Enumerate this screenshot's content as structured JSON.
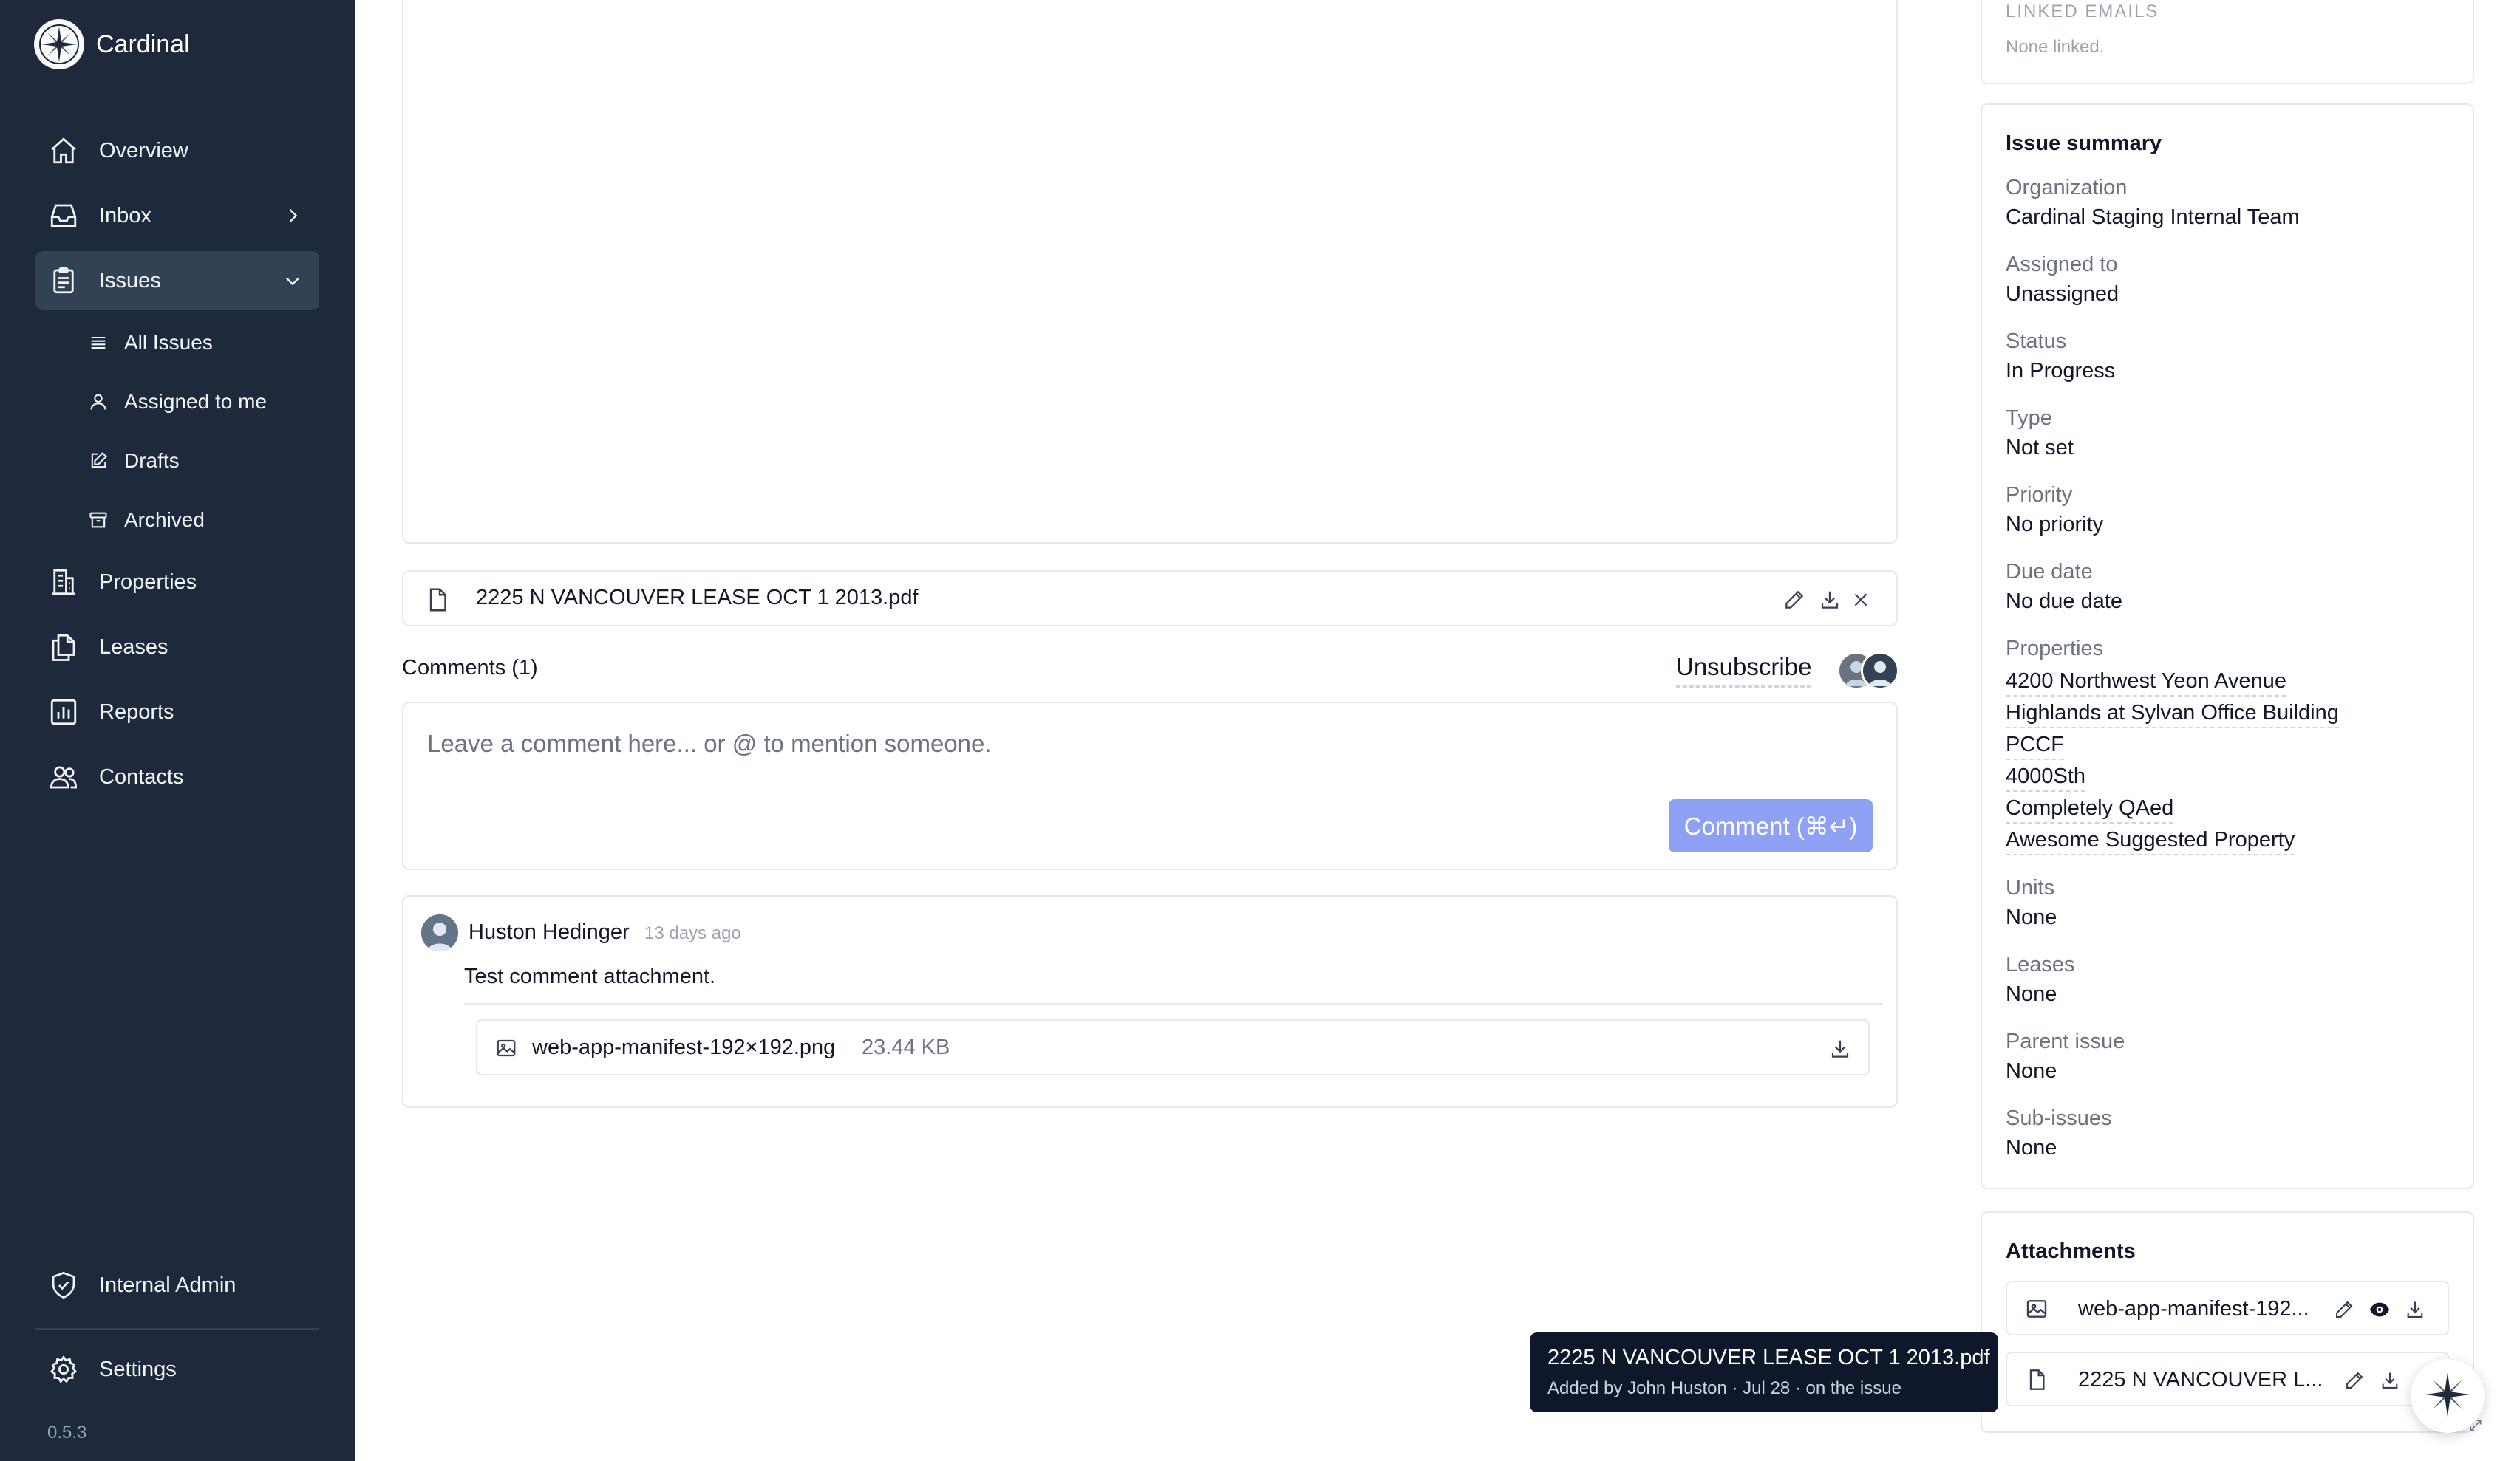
{
  "app": {
    "name": "Cardinal",
    "version": "0.5.3"
  },
  "sidebar": {
    "nav": [
      {
        "label": "Overview",
        "icon": "home-icon"
      },
      {
        "label": "Inbox",
        "icon": "inbox-icon"
      },
      {
        "label": "Issues",
        "icon": "clipboard-icon",
        "active": true
      },
      {
        "label": "Properties",
        "icon": "building-icon"
      },
      {
        "label": "Leases",
        "icon": "documents-icon"
      },
      {
        "label": "Reports",
        "icon": "chart-icon"
      },
      {
        "label": "Contacts",
        "icon": "users-icon"
      }
    ],
    "issues_sub": [
      {
        "label": "All Issues",
        "icon": "list-icon"
      },
      {
        "label": "Assigned to me",
        "icon": "user-icon"
      },
      {
        "label": "Drafts",
        "icon": "pencil-square-icon"
      },
      {
        "label": "Archived",
        "icon": "archive-icon"
      }
    ],
    "internal_admin": "Internal Admin",
    "settings": "Settings"
  },
  "main": {
    "attached_file": "2225 N VANCOUVER LEASE OCT 1 2013.pdf",
    "comments_title": "Comments (1)",
    "unsubscribe": "Unsubscribe",
    "comment_placeholder": "Leave a comment here... or @ to mention someone.",
    "comment_button": "Comment (⌘↵)",
    "comment": {
      "author": "Huston Hedinger",
      "time": "13 days ago",
      "text": "Test comment attachment.",
      "attachment_name": "web-app-manifest-192×192.png",
      "attachment_size": "23.44 KB"
    }
  },
  "right_panel": {
    "linked_emails_title": "LINKED EMAILS",
    "linked_emails_value": "None linked.",
    "summary_title": "Issue summary",
    "fields": {
      "organization": {
        "label": "Organization",
        "value": "Cardinal Staging Internal Team"
      },
      "assigned": {
        "label": "Assigned to",
        "value": "Unassigned"
      },
      "status": {
        "label": "Status",
        "value": "In Progress"
      },
      "type": {
        "label": "Type",
        "value": "Not set"
      },
      "priority": {
        "label": "Priority",
        "value": "No priority"
      },
      "due": {
        "label": "Due date",
        "value": "No due date"
      },
      "properties_label": "Properties",
      "properties": [
        "4200 Northwest Yeon Avenue",
        "Highlands at Sylvan Office Building",
        "PCCF",
        "4000Sth",
        "Completely QAed",
        "Awesome Suggested Property"
      ],
      "units": {
        "label": "Units",
        "value": "None"
      },
      "leases": {
        "label": "Leases",
        "value": "None"
      },
      "parent": {
        "label": "Parent issue",
        "value": "None"
      },
      "sub": {
        "label": "Sub-issues",
        "value": "None"
      }
    },
    "attachments_title": "Attachments",
    "attachments": [
      {
        "name": "web-app-manifest-192...",
        "icon": "image-icon"
      },
      {
        "name": "2225 N VANCOUVER L...",
        "icon": "file-icon"
      }
    ]
  },
  "tooltip": {
    "title": "2225 N VANCOUVER LEASE OCT 1 2013.pdf",
    "subtitle": "Added by John Huston · Jul 28 · on the issue"
  },
  "colors": {
    "sidebar_bg": "#1e293b",
    "sidebar_active": "#334155",
    "comment_button": "#8fa1f5",
    "tooltip_bg": "#0f172a"
  }
}
